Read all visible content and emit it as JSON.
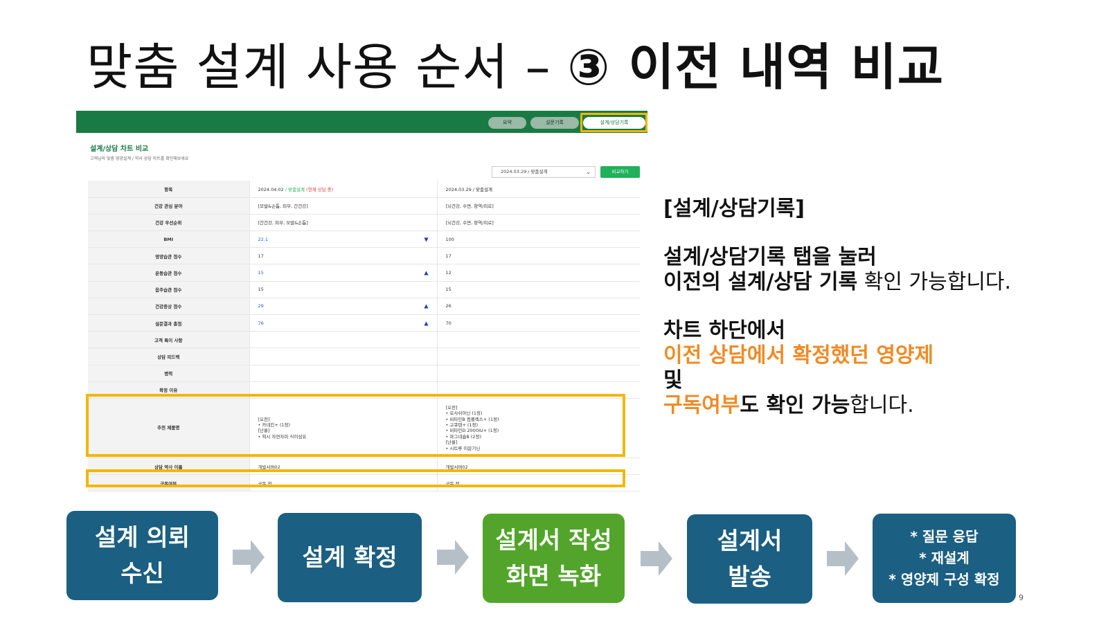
{
  "title": {
    "part1": "맞춤 설계 사용 순서 – ",
    "part2": "③ 이전 내역 비교"
  },
  "screenshot": {
    "tabs": [
      "요약",
      "설문기록",
      "설계/상담기록"
    ],
    "active_tab_index": 2,
    "heading": "설계/상담 차트 비교",
    "description": "고객님의 맞춤 영양설계 / 약사 상담 차트를 확인해보세요",
    "date_select": "2024.03.29 / 맞춤설계",
    "compare_button": "비교하기",
    "table": {
      "header": {
        "label": "항목",
        "current_date": "2024.04.02",
        "current_type": " / 맞춤설계",
        "current_status": " (현재 상담 중)",
        "previous": "2024.03.29 / 맞춤설계"
      },
      "rows": [
        {
          "label": "건강 관심 분야",
          "current": "[모발&손톱, 피부, 간건강]",
          "previous": "[뇌건강, 수면, 항역/피로]",
          "change": ""
        },
        {
          "label": "건강 우선순위",
          "current": "[간건강, 피부, 모발&손톱]",
          "previous": "[뇌건강, 수면, 항역/피로]",
          "change": ""
        },
        {
          "label": "BMI",
          "current": "22.1",
          "previous": "100",
          "change": "down"
        },
        {
          "label": "영양습관 점수",
          "current": "17",
          "previous": "17",
          "change": ""
        },
        {
          "label": "운동습관 점수",
          "current": "15",
          "previous": "12",
          "change": "up"
        },
        {
          "label": "음주습관 점수",
          "current": "15",
          "previous": "15",
          "change": ""
        },
        {
          "label": "건강증상 점수",
          "current": "29",
          "previous": "26",
          "change": "up"
        },
        {
          "label": "설문결과 총점",
          "current": "76",
          "previous": "70",
          "change": "up"
        },
        {
          "label": "고객 특이 사항",
          "current": "",
          "previous": "",
          "change": ""
        },
        {
          "label": "상담 피드백",
          "current": "",
          "previous": "",
          "change": ""
        },
        {
          "label": "병력",
          "current": "",
          "previous": "",
          "change": ""
        },
        {
          "label": "확정 이유",
          "current": "",
          "previous": "",
          "change": ""
        }
      ],
      "recommended": {
        "label": "추천 제품명",
        "current": "[오전]\n• 카네킨+ (1정)\n[난롱]\n• 웍시 자연자미 식이섬유",
        "previous": "[오전]\n• 로사쉬아닌 (1정)\n• 비타민B 컴플렉스+ (1정)\n• 고큐텐+ (1정)\n• 비타민D 2000IU+ (1정)\n• 마그네슘B (2정)\n[난롱]\n• 시트루 이뮨기닌"
      },
      "pharmacist": {
        "label": "상담 약사 이름",
        "current": "개발서버02",
        "previous": "개발서버02"
      },
      "subscription": {
        "label": "구독여부",
        "current": "구독 전",
        "previous": "구독 전"
      }
    }
  },
  "right_text": {
    "heading": "[설계/상담기록]",
    "p1_line1": "설계/상담기록 탭을 눌러",
    "p1_line2_bold": "이전의 설계/상담 기록",
    "p1_line2_rest": " 확인 가능합니다.",
    "p2_line1": "차트 하단에서",
    "p2_line2": "이전 상담에서 확정했던 영양제",
    "p2_line3": "및",
    "p2_line4_orange": "구독여부",
    "p2_line4_bold": "도 확인 가능",
    "p2_line4_rest": "합니다."
  },
  "flow": {
    "step1_line1": "설계 의뢰",
    "step1_line2": "수신",
    "step2": "설계 확정",
    "step3_line1": "설계서 작성",
    "step3_line2": "화면 녹화",
    "step4_line1": "설계서",
    "step4_line2": "발송",
    "step5_line1": "* 질문 응답",
    "step5_line2": "* 재설계",
    "step5_line3": "* 영양제 구성 확정"
  },
  "page_number": "9",
  "colors": {
    "header_green": "#1a7a44",
    "highlight": "#f2b705",
    "flow_blue": "#1b5f82",
    "flow_green": "#52a52a",
    "emphasis_orange": "#f08a24"
  }
}
